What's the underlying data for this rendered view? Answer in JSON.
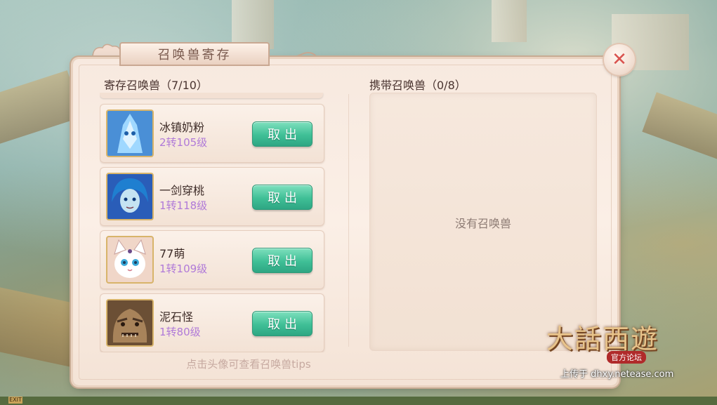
{
  "dialog": {
    "title": "召唤兽寄存",
    "close_label": "✕"
  },
  "left_section": {
    "label": "寄存召唤兽（7/10）",
    "pets": [
      {
        "name": "冰镇奶粉",
        "level": "2转105级",
        "avatar": "ice-beast-avatar",
        "button": "取出"
      },
      {
        "name": "一剑穿桃",
        "level": "1转118级",
        "avatar": "blue-haired-warrior-avatar",
        "button": "取出"
      },
      {
        "name": "77萌",
        "level": "1转109级",
        "avatar": "white-cat-avatar",
        "button": "取出"
      },
      {
        "name": "泥石怪",
        "level": "1转80级",
        "avatar": "mud-rock-monster-avatar",
        "button": "取出"
      }
    ]
  },
  "right_section": {
    "label": "携带召唤兽（0/8）",
    "empty_text": "没有召唤兽"
  },
  "hint": "点击头像可查看召唤兽tips",
  "watermark": {
    "logo_text": "大話西遊",
    "sub": "官方论坛",
    "upload": "上传于 dhxy.netease.com"
  },
  "exit_badge": "EXIT",
  "colors": {
    "button_green": "#3fbf96",
    "level_purple": "#b07ad8",
    "close_red": "#d9534f",
    "panel_bg": "#fbefe6"
  }
}
